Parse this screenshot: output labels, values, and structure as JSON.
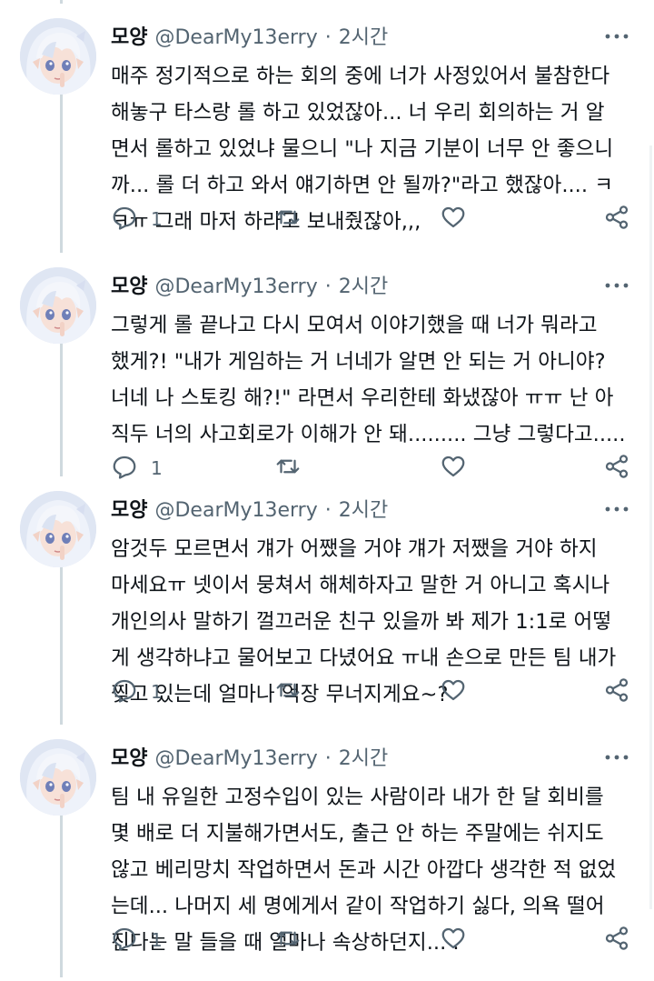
{
  "tweets": [
    {
      "name": "모양",
      "handle": "@DearMy13erry",
      "separator": "·",
      "time": "2시간",
      "lines": [
        "매주 정기적으로 하는 회의 중에 너가 사정있어서 불참한다",
        "해놓구 타스랑 롤 하고 있었잖아... 너 우리 회의하는 거 알",
        "면서 롤하고 있었냐 물으니 \"나 지금 기분이 너무 안 좋으니",
        "까... 롤 더 하고 와서 얘기하면 안 될까?\"라고 했잖아.... ㅋ",
        "ㅋㅠ 그래 마저 하라고 보내줬잖아,,,"
      ],
      "reply_count": "1"
    },
    {
      "name": "모양",
      "handle": "@DearMy13erry",
      "separator": "·",
      "time": "2시간",
      "lines": [
        "그렇게 롤 끝나고 다시 모여서 이야기했을 때 너가 뭐라고",
        "했게?! \"내가 게임하는 거 너네가 알면 안 되는 거 아니야?",
        "너네 나 스토킹 해?!\" 라면서 우리한테 화냈잖아 ㅠㅠ 난 아",
        "직두 너의 사고회로가 이해가 안 돼......... 그냥 그렇다고....."
      ],
      "reply_count": "1"
    },
    {
      "name": "모양",
      "handle": "@DearMy13erry",
      "separator": "·",
      "time": "2시간",
      "lines": [
        "암것두 모르면서 걔가 어쨌을 거야 걔가 저쨌을 거야 하지",
        "마세요ㅠ 넷이서 뭉쳐서 해체하자고 말한 거 아니고 혹시나",
        "개인의사 말하기 껄끄러운 친구 있을까 봐 제가 1:1로 어떻",
        "게 생각하냐고 물어보고 다녔어요 ㅠ내 손으로 만든 팀 내가",
        "찢고 있는데 얼마나 억장 무너지게요~?"
      ],
      "reply_count": "1"
    },
    {
      "name": "모양",
      "handle": "@DearMy13erry",
      "separator": "·",
      "time": "2시간",
      "lines": [
        "팀 내 유일한 고정수입이 있는 사람이라 내가 한 달 회비를",
        "몇 배로 더 지불해가면서도, 출근 안 하는 주말에는 쉬지도",
        "않고 베리망치 작업하면서 돈과 시간 아깝다 생각한 적 없었",
        "는데... 나머지 세 명에게서 같이 작업하기 싫다, 의욕 떨어",
        "진다는 말 들을 때 얼마나 속상하던지... ."
      ],
      "reply_count": "1"
    }
  ],
  "icons": {
    "more": "more-horizontal-icon",
    "reply": "reply-bubble-icon",
    "retweet": "retweet-icon",
    "like": "heart-icon",
    "share": "share-icon"
  },
  "colors": {
    "text": "#0f1419",
    "secondary": "#536471",
    "thread_line": "#cfd9de",
    "avatar_hair": "#e8eef8",
    "avatar_skin": "#f6ddd4"
  }
}
